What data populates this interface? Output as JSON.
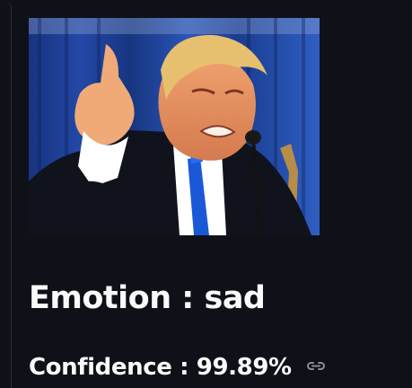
{
  "result": {
    "emotion_label": "Emotion : sad",
    "confidence_label": "Confidence : 99.89%"
  },
  "icons": {
    "anchor_link": "link-icon"
  },
  "colors": {
    "background": "#0e1117",
    "text": "#fafafa",
    "link_icon": "#8b8d94"
  }
}
